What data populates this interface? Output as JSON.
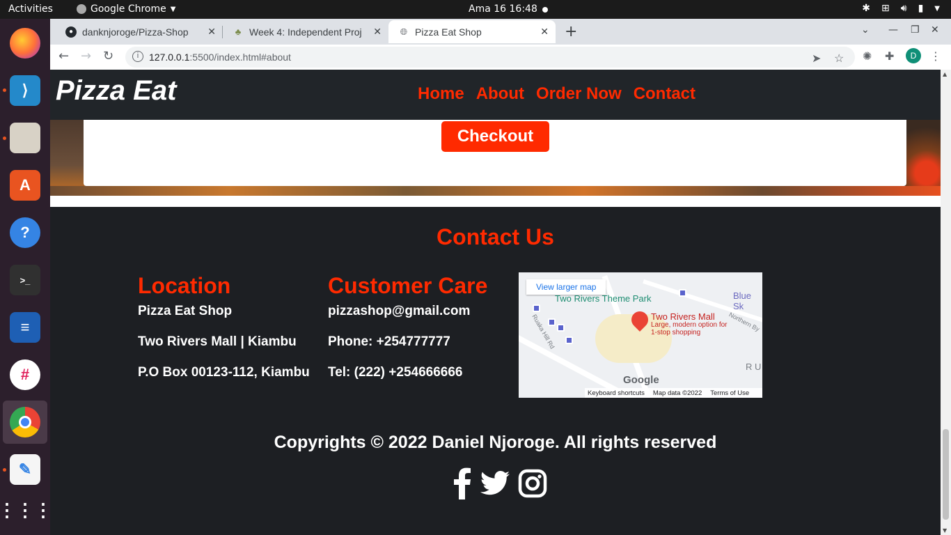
{
  "system": {
    "activities": "Activities",
    "app_name": "Google Chrome",
    "clock": "Ama 16  16:48"
  },
  "dock": {
    "items": [
      "firefox-icon",
      "vscode-icon",
      "files-icon",
      "software-icon",
      "help-icon",
      "terminal-icon",
      "document-viewer-icon",
      "slack-icon",
      "chrome-icon",
      "text-editor-icon",
      "app-grid-icon"
    ]
  },
  "browser": {
    "tabs": [
      {
        "title": "danknjoroge/Pizza-Shop",
        "active": false
      },
      {
        "title": "Week 4: Independent Proj",
        "active": false
      },
      {
        "title": "Pizza Eat Shop",
        "active": true
      }
    ],
    "url_host": "127.0.0.1",
    "url_rest": ":5500/index.html#about",
    "profile_initial": "D"
  },
  "site": {
    "brand": "Pizza Eat",
    "nav": [
      "Home",
      "About",
      "Order Now",
      "Contact"
    ],
    "checkout_label": "Checkout",
    "contact_title": "Contact Us",
    "location": {
      "heading": "Location",
      "lines": [
        "Pizza Eat Shop",
        "Two Rivers Mall | Kiambu",
        "P.O Box 00123-112, Kiambu"
      ]
    },
    "care": {
      "heading": "Customer Care",
      "lines": [
        "pizzashop@gmail.com",
        "Phone: +254777777",
        "Tel: (222) +254666666"
      ]
    },
    "map": {
      "larger": "View larger map",
      "park": "Two Rivers Theme Park",
      "blue": "Blue Sk",
      "place": "Two Rivers Mall",
      "place_sub": "Large, modern option for 1-stop shopping",
      "road1": "Ruaka Hill Rd",
      "road2": "Northern By",
      "ru": "R U",
      "google": "Google",
      "shortcuts": "Keyboard shortcuts",
      "mapdata": "Map data ©2022",
      "terms": "Terms of Use"
    },
    "copyright": "Copyrights © 2022 Daniel Njoroge. All rights reserved"
  },
  "colors": {
    "accent": "#ff2a00",
    "dark": "#1d1f23"
  }
}
